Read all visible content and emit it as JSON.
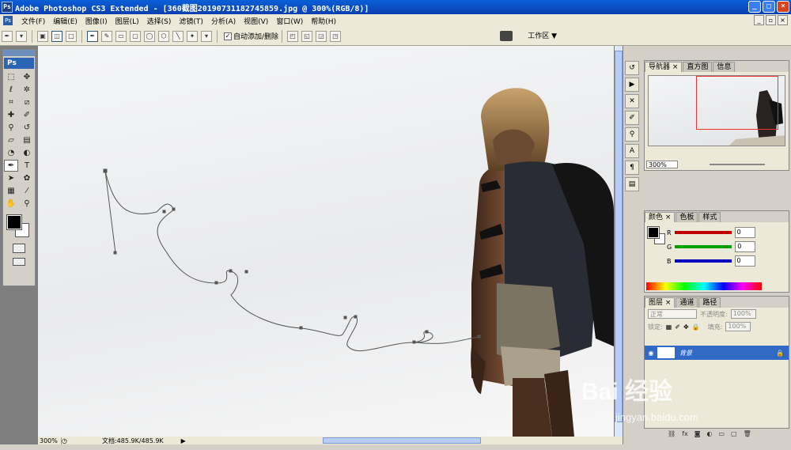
{
  "window": {
    "title": "Adobe Photoshop CS3 Extended - [360截图20190731182745859.jpg @ 300%(RGB/8)]",
    "app_icon": "Ps",
    "minimize": "_",
    "maximize": "□",
    "close": "×"
  },
  "menu": {
    "items": [
      "文件(F)",
      "编辑(E)",
      "图像(I)",
      "图层(L)",
      "选择(S)",
      "滤镜(T)",
      "分析(A)",
      "视图(V)",
      "窗口(W)",
      "帮助(H)"
    ]
  },
  "options": {
    "auto_add_delete": "自动添加/删除",
    "workspace": "工作区 ▼"
  },
  "toolbox": {
    "logo": "Ps"
  },
  "status": {
    "zoom": "300%",
    "doc": "文档:485.9K/485.9K"
  },
  "navigator": {
    "tabs": [
      "导航器 ×",
      "直方图",
      "信息"
    ],
    "zoom": "300%"
  },
  "color_panel": {
    "tabs": [
      "颜色 ×",
      "色板",
      "样式"
    ],
    "channels": [
      {
        "label": "R",
        "value": "0",
        "color": "#c00000"
      },
      {
        "label": "G",
        "value": "0",
        "color": "#00a000"
      },
      {
        "label": "B",
        "value": "0",
        "color": "#0000c0"
      }
    ]
  },
  "layers_panel": {
    "tabs": [
      "图层 ×",
      "通道",
      "路径"
    ],
    "blend_mode": "正常",
    "opacity_label": "不透明度:",
    "opacity": "100%",
    "lock_label": "锁定:",
    "fill_label": "填充:",
    "fill": "100%",
    "layer_name": "背景"
  },
  "watermark": {
    "brand": "Bai 经验",
    "url": "jingyan.baidu.com"
  },
  "colors": {
    "title_bar": "#0a5fd8",
    "selected_layer": "#3169c6"
  }
}
